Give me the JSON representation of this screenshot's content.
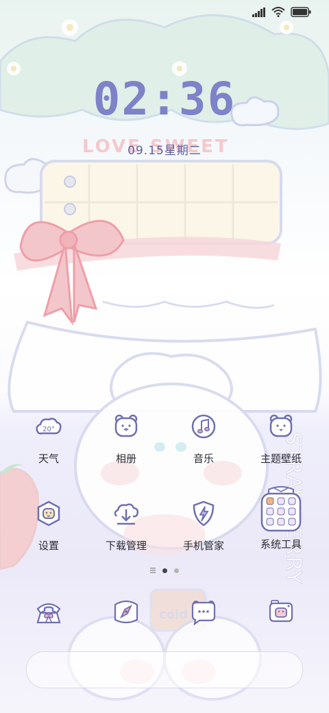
{
  "status_bar": {
    "signal_icon": "signal-icon",
    "wifi_icon": "wifi-icon",
    "battery_icon": "battery-icon"
  },
  "lockclock": {
    "time": "02:36",
    "date": "09.15星期二"
  },
  "wallpaper_text": {
    "banner": "LOVE SWEET",
    "side": "STRAWBERRY",
    "cup": "cold"
  },
  "weather": {
    "temperature": "20°"
  },
  "apps": [
    {
      "label": "天气",
      "icon": "weather-cloud-icon"
    },
    {
      "label": "相册",
      "icon": "bear-face-icon"
    },
    {
      "label": "音乐",
      "icon": "music-note-icon"
    },
    {
      "label": "主题壁纸",
      "icon": "bear-face-icon"
    },
    {
      "label": "设置",
      "icon": "bear-hexagon-icon"
    },
    {
      "label": "下载管理",
      "icon": "cloud-download-icon"
    },
    {
      "label": "手机管家",
      "icon": "shield-bolt-icon"
    },
    {
      "label": "系统工具",
      "icon": "jar-folder-icon"
    }
  ],
  "page_indicator": {
    "menu_icon": "menu-lines-icon",
    "pages": 2,
    "current": 1
  },
  "dock": [
    {
      "icon": "phone-icon"
    },
    {
      "icon": "compass-icon"
    },
    {
      "icon": "chat-bear-icon"
    },
    {
      "icon": "camera-icon"
    }
  ],
  "colors": {
    "accent": "#7e82c8",
    "icon_stroke": "#6e6fb0",
    "label": "#2b2b33"
  }
}
